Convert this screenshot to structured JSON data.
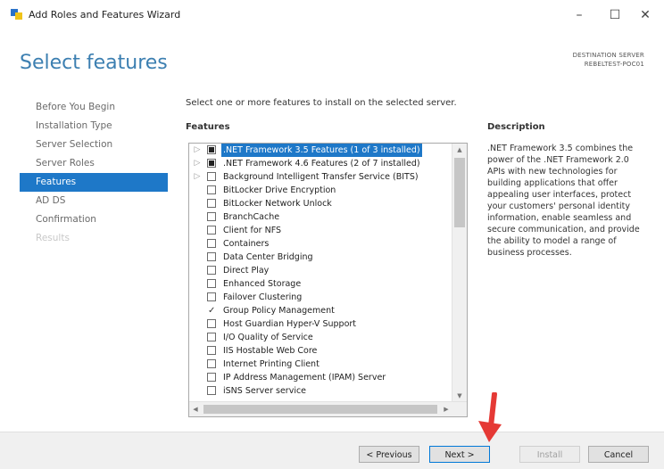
{
  "window": {
    "title": "Add Roles and Features Wizard"
  },
  "window_controls": {
    "minimize": "–",
    "maximize": "☐",
    "close": "✕"
  },
  "page": {
    "title": "Select features",
    "destination_label": "DESTINATION SERVER",
    "destination_server": "REBELTEST-POC01"
  },
  "nav": {
    "items": [
      {
        "label": "Before You Begin",
        "state": "normal"
      },
      {
        "label": "Installation Type",
        "state": "normal"
      },
      {
        "label": "Server Selection",
        "state": "normal"
      },
      {
        "label": "Server Roles",
        "state": "normal"
      },
      {
        "label": "Features",
        "state": "active"
      },
      {
        "label": "AD DS",
        "state": "normal"
      },
      {
        "label": "Confirmation",
        "state": "normal"
      },
      {
        "label": "Results",
        "state": "disabled"
      }
    ]
  },
  "main": {
    "instruction": "Select one or more features to install on the selected server.",
    "features_label": "Features",
    "description_label": "Description",
    "description_text": ".NET Framework 3.5 combines the power of the .NET Framework 2.0 APIs with new technologies for building applications that offer appealing user interfaces, protect your customers' personal identity information, enable seamless and secure communication, and provide the ability to model a range of business processes.",
    "features": [
      {
        "label": ".NET Framework 3.5 Features (1 of 3 installed)",
        "state": "partial",
        "expandable": true,
        "selected": true
      },
      {
        "label": ".NET Framework 4.6 Features (2 of 7 installed)",
        "state": "partial",
        "expandable": true,
        "selected": false
      },
      {
        "label": "Background Intelligent Transfer Service (BITS)",
        "state": "unchecked",
        "expandable": true,
        "selected": false
      },
      {
        "label": "BitLocker Drive Encryption",
        "state": "unchecked",
        "expandable": false,
        "selected": false
      },
      {
        "label": "BitLocker Network Unlock",
        "state": "unchecked",
        "expandable": false,
        "selected": false
      },
      {
        "label": "BranchCache",
        "state": "unchecked",
        "expandable": false,
        "selected": false
      },
      {
        "label": "Client for NFS",
        "state": "unchecked",
        "expandable": false,
        "selected": false
      },
      {
        "label": "Containers",
        "state": "unchecked",
        "expandable": false,
        "selected": false
      },
      {
        "label": "Data Center Bridging",
        "state": "unchecked",
        "expandable": false,
        "selected": false
      },
      {
        "label": "Direct Play",
        "state": "unchecked",
        "expandable": false,
        "selected": false
      },
      {
        "label": "Enhanced Storage",
        "state": "unchecked",
        "expandable": false,
        "selected": false
      },
      {
        "label": "Failover Clustering",
        "state": "unchecked",
        "expandable": false,
        "selected": false
      },
      {
        "label": "Group Policy Management",
        "state": "checked",
        "expandable": false,
        "selected": false
      },
      {
        "label": "Host Guardian Hyper-V Support",
        "state": "unchecked",
        "expandable": false,
        "selected": false
      },
      {
        "label": "I/O Quality of Service",
        "state": "unchecked",
        "expandable": false,
        "selected": false
      },
      {
        "label": "IIS Hostable Web Core",
        "state": "unchecked",
        "expandable": false,
        "selected": false
      },
      {
        "label": "Internet Printing Client",
        "state": "unchecked",
        "expandable": false,
        "selected": false
      },
      {
        "label": "IP Address Management (IPAM) Server",
        "state": "unchecked",
        "expandable": false,
        "selected": false
      },
      {
        "label": "iSNS Server service",
        "state": "unchecked",
        "expandable": false,
        "selected": false
      }
    ]
  },
  "footer": {
    "previous_label": "< Previous",
    "next_label": "Next >",
    "install_label": "Install",
    "cancel_label": "Cancel"
  },
  "colors": {
    "accent": "#1e78c8",
    "title": "#3c7fb1",
    "annotation_arrow": "#e53935"
  }
}
